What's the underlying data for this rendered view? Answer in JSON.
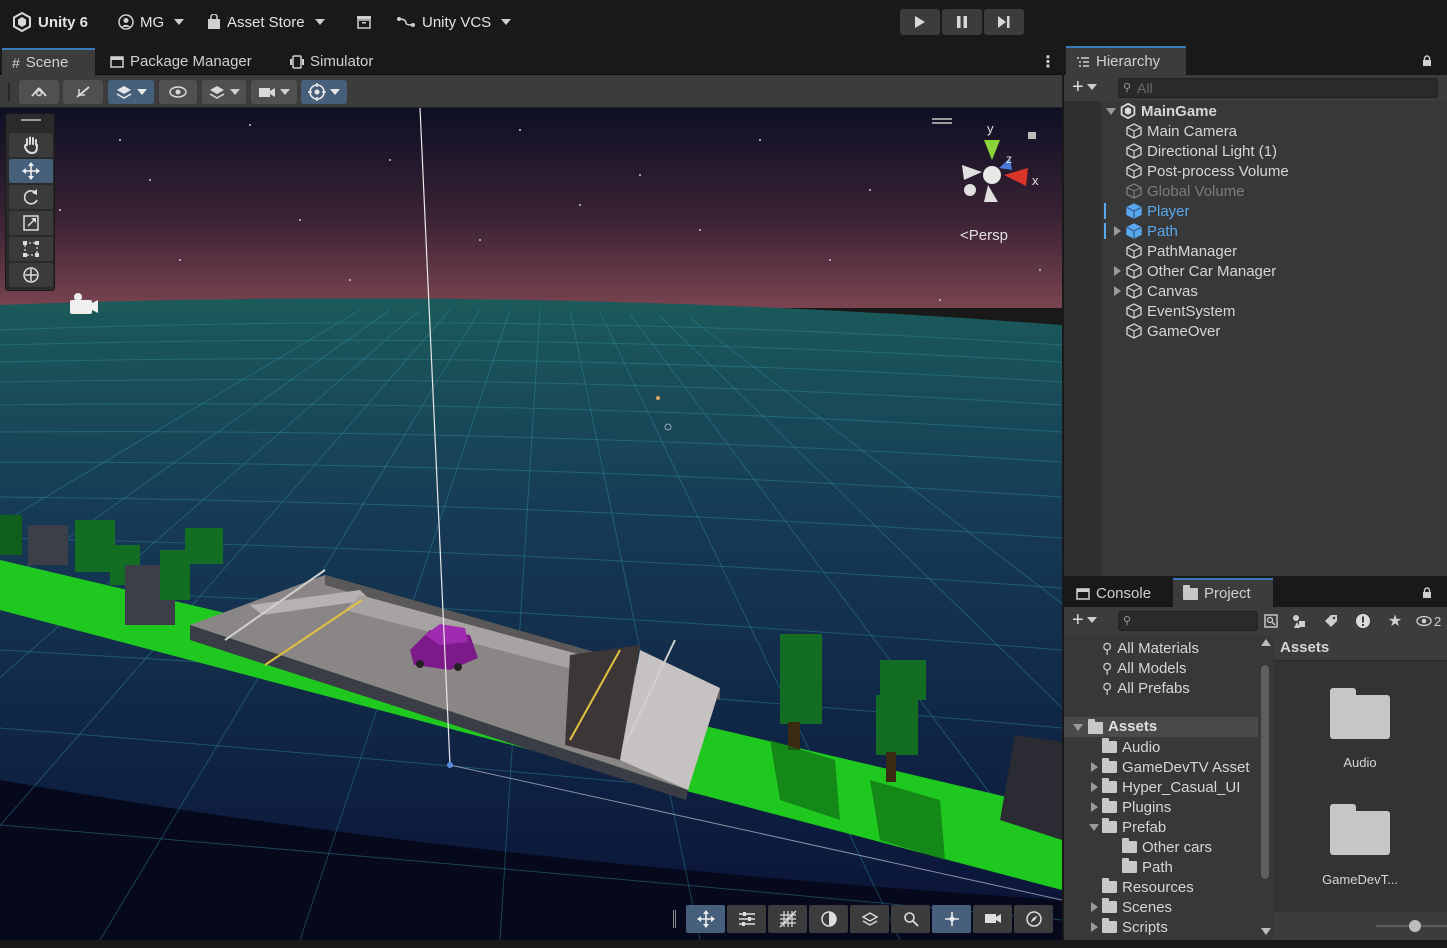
{
  "topbar": {
    "app_label": "Unity 6",
    "account_label": "MG",
    "asset_store_label": "Asset Store",
    "vcs_label": "Unity VCS"
  },
  "scene_tabs": [
    {
      "label": "Scene"
    },
    {
      "label": "Package Manager"
    },
    {
      "label": "Simulator"
    }
  ],
  "viewport": {
    "projection_label": "Persp",
    "gizmo": {
      "x": "x",
      "y": "y",
      "z": "z"
    }
  },
  "hierarchy": {
    "tab_label": "Hierarchy",
    "search_placeholder": "All",
    "scene_name": "MainGame",
    "items": [
      {
        "label": "Main Camera",
        "state": "normal",
        "expandable": false
      },
      {
        "label": "Directional Light (1)",
        "state": "normal",
        "expandable": false
      },
      {
        "label": "Post-process Volume",
        "state": "normal",
        "expandable": false
      },
      {
        "label": "Global Volume",
        "state": "disabled",
        "expandable": false
      },
      {
        "label": "Player",
        "state": "prefab",
        "expandable": false
      },
      {
        "label": "Path",
        "state": "prefab",
        "expandable": true
      },
      {
        "label": "PathManager",
        "state": "normal",
        "expandable": false
      },
      {
        "label": "Other Car Manager",
        "state": "normal",
        "expandable": true
      },
      {
        "label": "Canvas",
        "state": "normal",
        "expandable": true
      },
      {
        "label": "EventSystem",
        "state": "normal",
        "expandable": false
      },
      {
        "label": "GameOver",
        "state": "normal",
        "expandable": false
      }
    ]
  },
  "project": {
    "tabs": [
      {
        "label": "Console"
      },
      {
        "label": "Project"
      }
    ],
    "badge_count": "2",
    "favorites": [
      "All Materials",
      "All Models",
      "All Prefabs"
    ],
    "assets_root": "Assets",
    "tree": [
      {
        "label": "Audio",
        "expandable": false,
        "expanded": false
      },
      {
        "label": "GameDevTV Asset",
        "expandable": true,
        "expanded": false
      },
      {
        "label": "Hyper_Casual_UI",
        "expandable": true,
        "expanded": false
      },
      {
        "label": "Plugins",
        "expandable": true,
        "expanded": false
      },
      {
        "label": "Prefab",
        "expandable": true,
        "expanded": true
      },
      {
        "label": "Other cars",
        "expandable": false,
        "expanded": false
      },
      {
        "label": "Path",
        "expandable": false,
        "expanded": false
      },
      {
        "label": "Resources",
        "expandable": false,
        "expanded": false
      },
      {
        "label": "Scenes",
        "expandable": true,
        "expanded": false
      },
      {
        "label": "Scripts",
        "expandable": true,
        "expanded": false
      }
    ],
    "content_header": "Assets",
    "content_items": [
      {
        "label": "Audio"
      },
      {
        "label": "GameDevT..."
      }
    ]
  },
  "colors": {
    "accent": "#46607c",
    "prefab_blue": "#59a8ee",
    "grass": "#1fc81f",
    "sky_top": "#0d0f24",
    "horizon": "#7a4450"
  }
}
